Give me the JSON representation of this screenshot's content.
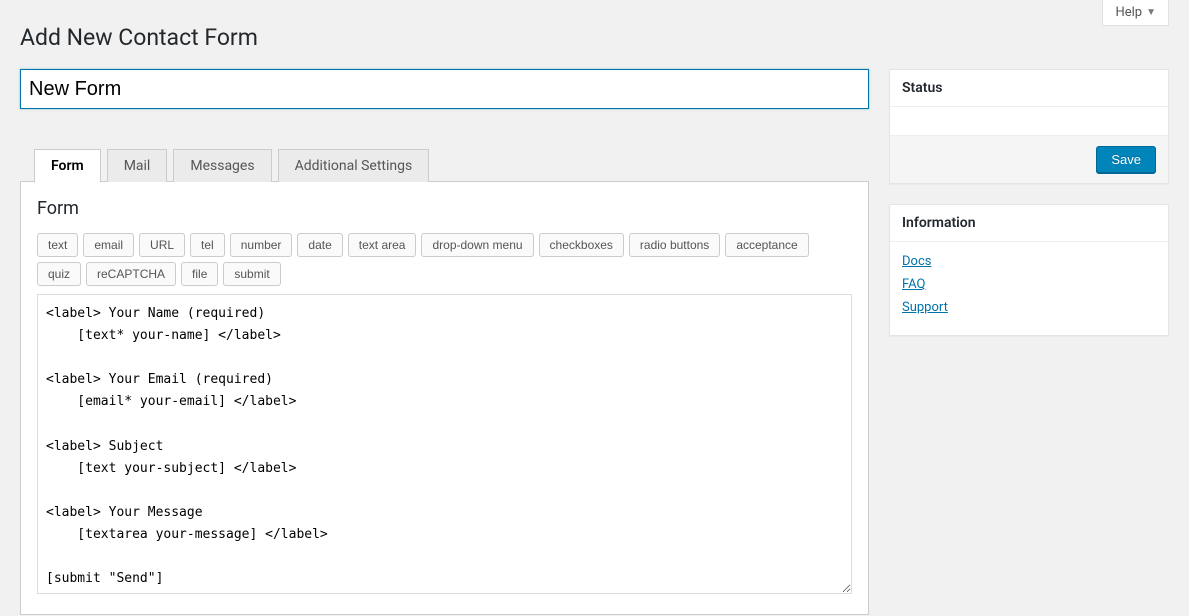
{
  "help_label": "Help",
  "page_title": "Add New Contact Form",
  "title_input_value": "New Form",
  "tabs": [
    "Form",
    "Mail",
    "Messages",
    "Additional Settings"
  ],
  "active_tab": 0,
  "form_panel": {
    "heading": "Form",
    "tag_buttons": [
      "text",
      "email",
      "URL",
      "tel",
      "number",
      "date",
      "text area",
      "drop-down menu",
      "checkboxes",
      "radio buttons",
      "acceptance",
      "quiz",
      "reCAPTCHA",
      "file",
      "submit"
    ],
    "code": "<label> Your Name (required)\n    [text* your-name] </label>\n\n<label> Your Email (required)\n    [email* your-email] </label>\n\n<label> Subject\n    [text your-subject] </label>\n\n<label> Your Message\n    [textarea your-message] </label>\n\n[submit \"Send\"]"
  },
  "sidebar": {
    "status": {
      "title": "Status",
      "save_label": "Save"
    },
    "information": {
      "title": "Information",
      "links": [
        "Docs",
        "FAQ",
        "Support"
      ]
    }
  }
}
